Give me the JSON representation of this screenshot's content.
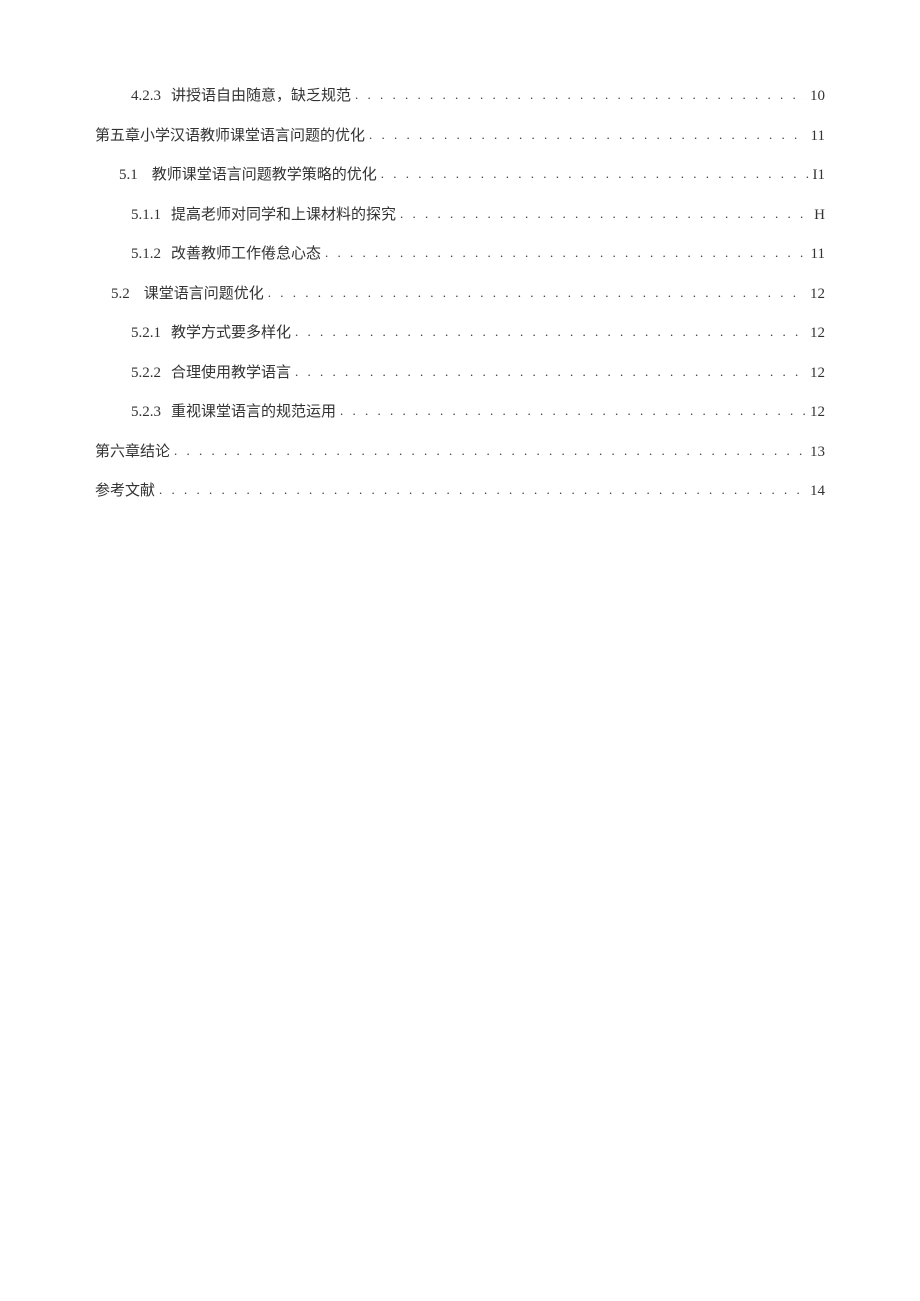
{
  "toc": [
    {
      "indent": "indent-1",
      "num": "4.2.3",
      "title": "讲授语自由随意，缺乏规范",
      "page": "10"
    },
    {
      "indent": "indent-3",
      "num": "",
      "title": "第五章小学汉语教师课堂语言问题的优化",
      "page": "11"
    },
    {
      "indent": "indent-2",
      "num": "5.1",
      "title": "教师课堂语言问题教学策略的优化",
      "page": "I1"
    },
    {
      "indent": "indent-1",
      "num": "5.1.1",
      "title": "提高老师对同学和上课材料的探究",
      "page": "H"
    },
    {
      "indent": "indent-1",
      "num": "5.1.2",
      "title": "改善教师工作倦怠心态",
      "page": "11"
    },
    {
      "indent": "indent-2a",
      "num": "5.2",
      "title": "课堂语言问题优化",
      "page": "12"
    },
    {
      "indent": "indent-1",
      "num": "5.2.1",
      "title": "教学方式要多样化",
      "page": "12"
    },
    {
      "indent": "indent-1",
      "num": "5.2.2",
      "title": "合理使用教学语言",
      "page": "12"
    },
    {
      "indent": "indent-1",
      "num": "5.2.3",
      "title": "重视课堂语言的规范运用",
      "page": "12"
    },
    {
      "indent": "indent-3",
      "num": "",
      "title": "第六章结论",
      "page": "13"
    },
    {
      "indent": "indent-3",
      "num": "",
      "title": "参考文献",
      "page": "14"
    }
  ],
  "dots": ". . . . . . . . . . . . . . . . . . . . . . . . . . . . . . . . . . . . . . . . . . . . . . . . . . . . . . . . . . . . . . . . . . . . . . . . . . . . . . . . . . . . . . . . . . . . . . . . . . . ."
}
